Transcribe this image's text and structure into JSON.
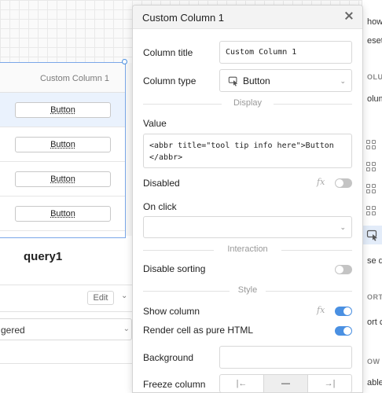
{
  "table": {
    "header": "Custom Column 1",
    "rows": [
      {
        "button": "Button",
        "selected": true
      },
      {
        "button": "Button",
        "selected": false
      },
      {
        "button": "Button",
        "selected": false
      },
      {
        "button": "Button",
        "selected": false
      }
    ]
  },
  "query_panel": {
    "title": "query1",
    "edit_label": "Edit",
    "trigger_value": "gered"
  },
  "right_strip": {
    "texts": [
      "how s",
      "eset a",
      "OLUM",
      "olum",
      "se dy",
      "ORTI",
      "ort co",
      "OW S",
      "able"
    ]
  },
  "panel": {
    "title": "Custom Column 1",
    "column_title": {
      "label": "Column title",
      "value": "Custom Column 1"
    },
    "column_type": {
      "label": "Column type",
      "value": "Button"
    },
    "sections": {
      "display": "Display",
      "interaction": "Interaction",
      "style": "Style"
    },
    "value": {
      "label": "Value",
      "code": "<abbr title=\"tool tip info here\">Button </abbr>"
    },
    "disabled": {
      "label": "Disabled",
      "fx": "fx",
      "on": false
    },
    "on_click": {
      "label": "On click",
      "value": ""
    },
    "disable_sorting": {
      "label": "Disable sorting",
      "on": false
    },
    "show_column": {
      "label": "Show column",
      "fx": "fx",
      "on": true
    },
    "render_html": {
      "label": "Render cell as pure HTML",
      "on": true
    },
    "background": {
      "label": "Background",
      "value": ""
    },
    "freeze_column": {
      "label": "Freeze column",
      "options": [
        "|←",
        "—",
        "→|"
      ],
      "selected": 1
    }
  },
  "colors": {
    "accent": "#4a90e2",
    "selection_border": "#7aa7e8",
    "selected_row": "#eaf2fd",
    "toggle_off": "#c4c4c4"
  }
}
